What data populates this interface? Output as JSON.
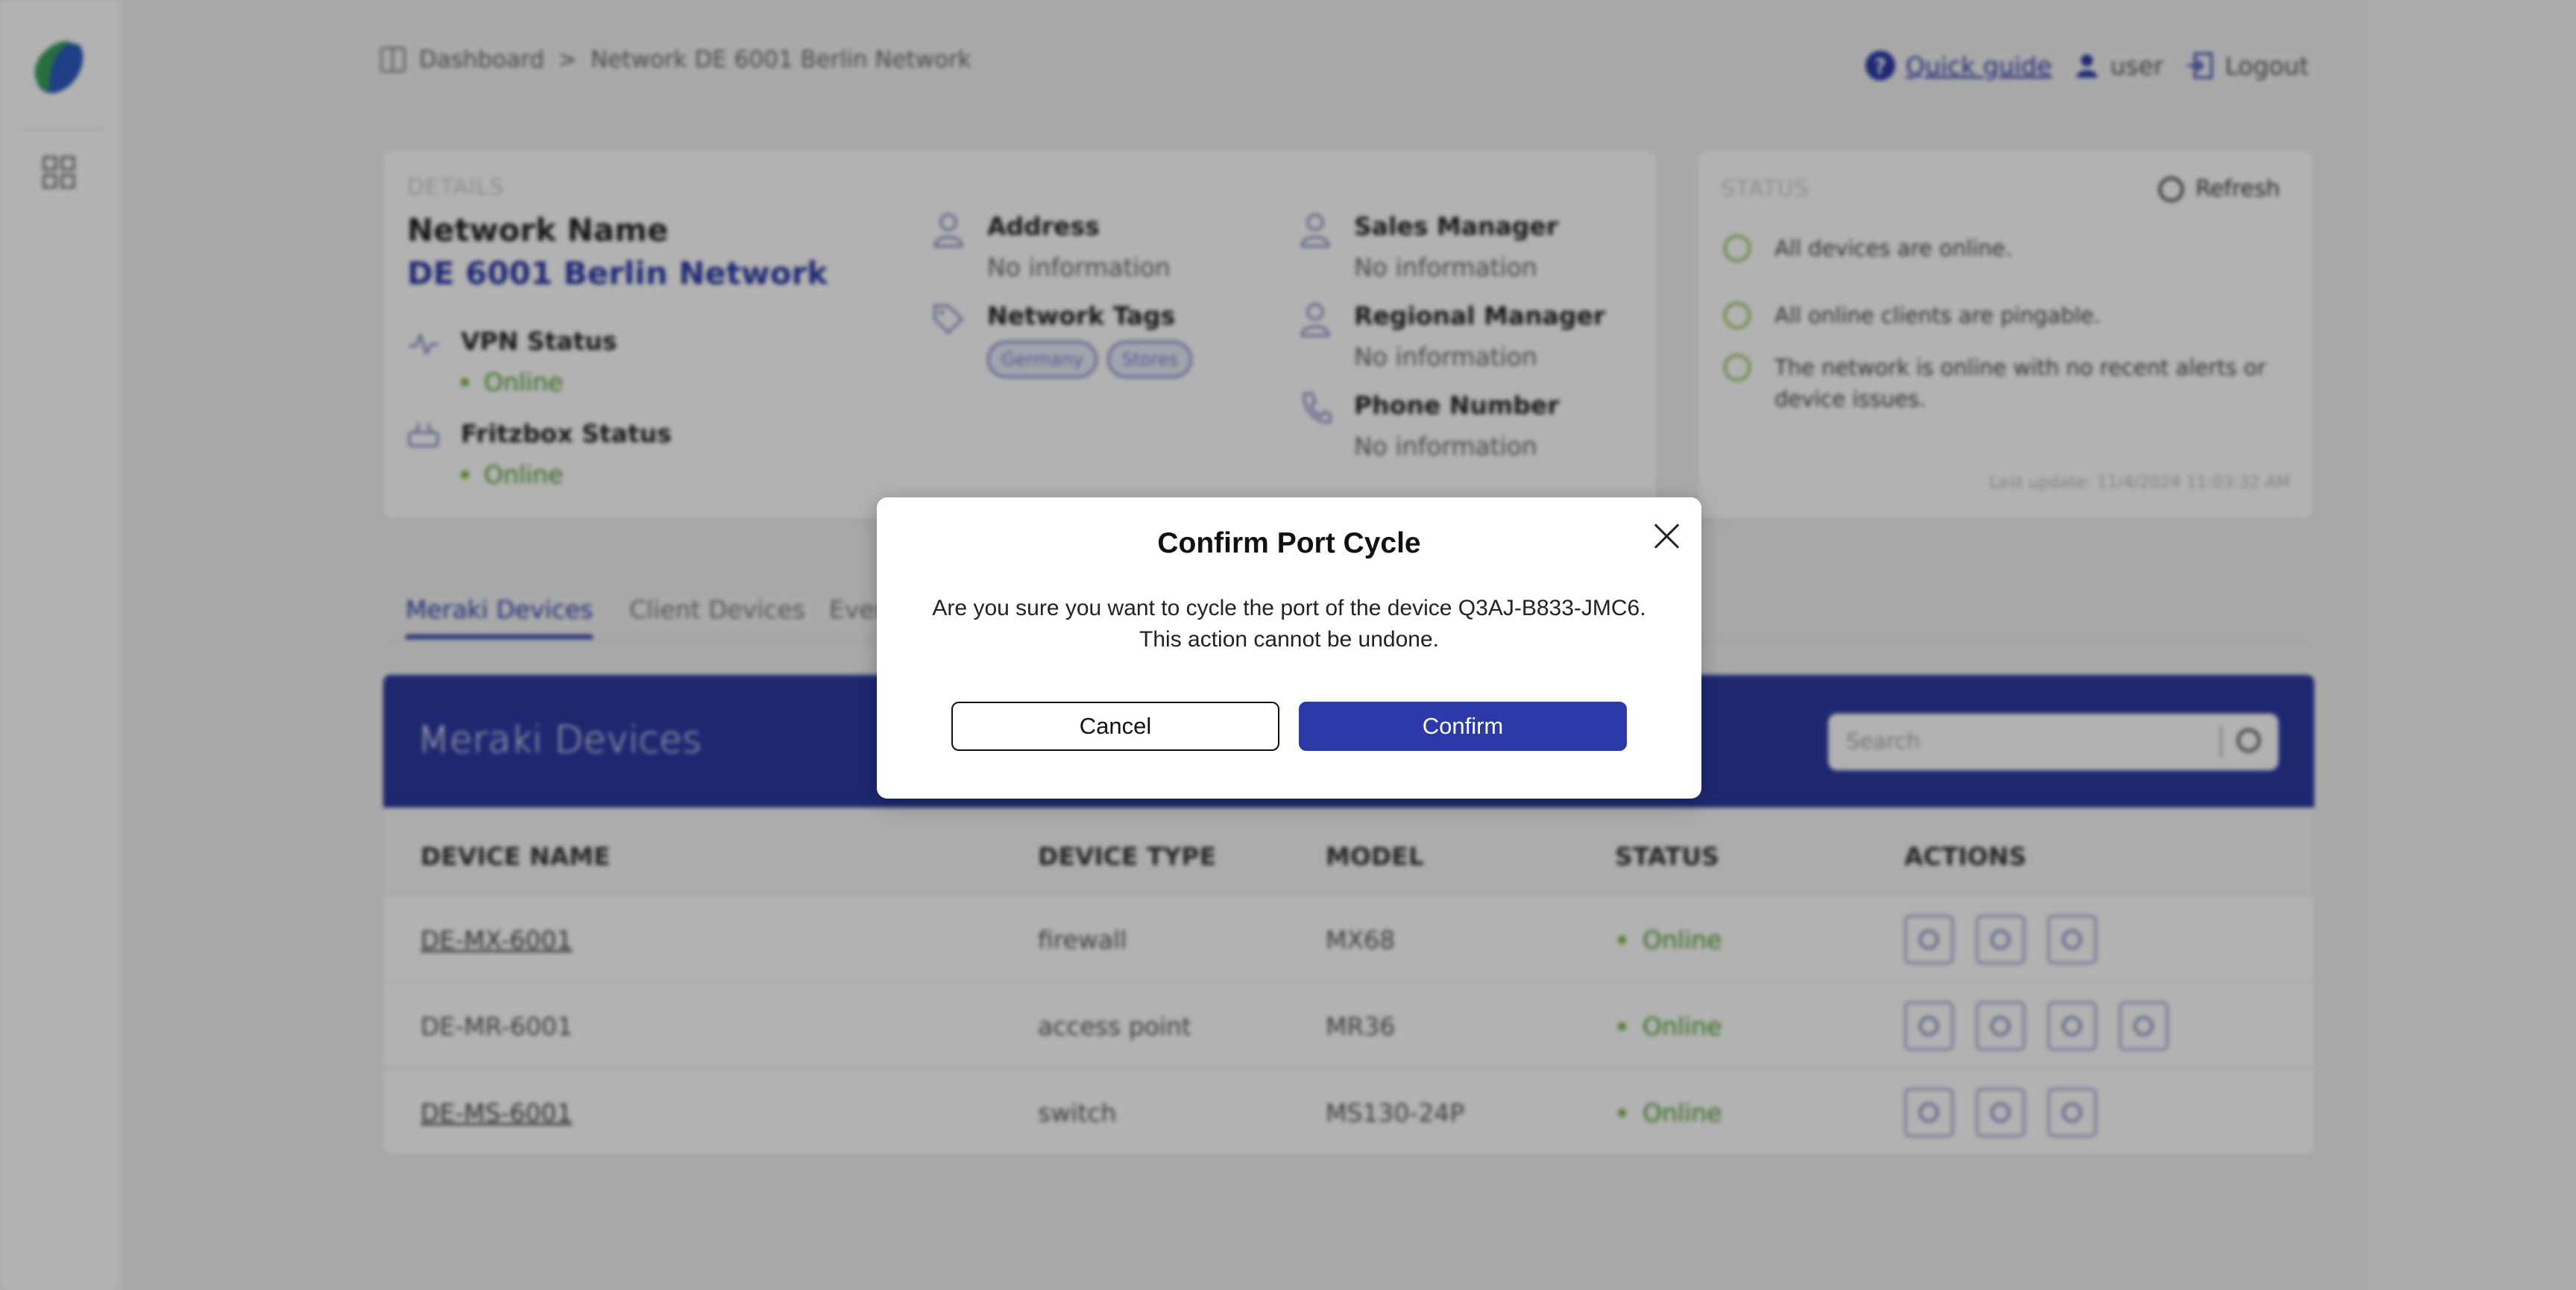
{
  "breadcrumb": {
    "home": "Dashboard",
    "separator": ">",
    "current": "Network DE 6001 Berlin Network"
  },
  "header": {
    "quick_guide": "Quick guide",
    "user": "user",
    "logout": "Logout"
  },
  "details": {
    "section_label": "DETAILS",
    "network_label": "Network Name",
    "network_name": "DE 6001 Berlin Network",
    "vpn_label": "VPN Status",
    "vpn_value": "Online",
    "fritzbox_label": "Fritzbox Status",
    "fritzbox_value": "Online",
    "address_label": "Address",
    "address_value": "No information",
    "tags_label": "Network Tags",
    "tags": [
      "Germany",
      "Stores"
    ],
    "sales_label": "Sales Manager",
    "sales_value": "No information",
    "regional_label": "Regional Manager",
    "regional_value": "No information",
    "phone_label": "Phone Number",
    "phone_value": "No information"
  },
  "status": {
    "section_label": "STATUS",
    "refresh": "Refresh",
    "items": [
      "All devices are online.",
      "All online clients are pingable.",
      "The network is online with no recent alerts or device issues."
    ],
    "last_update": "Last update: 11/4/2024 11:03:32 AM"
  },
  "tabs": [
    "Meraki Devices",
    "Client Devices",
    "Events"
  ],
  "devices": {
    "title": "Meraki Devices",
    "search_placeholder": "Search",
    "columns": [
      "DEVICE NAME",
      "DEVICE TYPE",
      "MODEL",
      "STATUS",
      "ACTIONS"
    ],
    "rows": [
      {
        "name": "DE-MX-6001",
        "type": "firewall",
        "model": "MX68",
        "status": "Online"
      },
      {
        "name": "DE-MR-6001",
        "type": "access point",
        "model": "MR36",
        "status": "Online"
      },
      {
        "name": "DE-MS-6001",
        "type": "switch",
        "model": "MS130-24P",
        "status": "Online"
      }
    ]
  },
  "modal": {
    "title": "Confirm Port Cycle",
    "message_line1": "Are you sure you want to cycle the port of the device Q3AJ-B833-JMC6.",
    "message_line2": "This action cannot be undone.",
    "cancel": "Cancel",
    "confirm": "Confirm"
  },
  "colors": {
    "primary": "#2b3aa6",
    "online": "#4a9a2a"
  }
}
